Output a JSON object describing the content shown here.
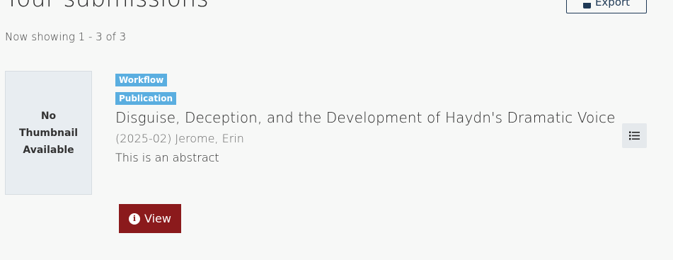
{
  "header": {
    "title": "Your submissions",
    "export_label": "Export"
  },
  "results": {
    "showing_text": "Now showing 1 - 3 of 3"
  },
  "item": {
    "thumbnail_text": "No Thumbnail Available",
    "badges": {
      "workflow": "Workflow",
      "publication": "Publication"
    },
    "title": "Disguise, Deception, and the Development of Haydn's Dramatic Voice",
    "meta": "(2025-02) Jerome, Erin",
    "abstract": "This is an abstract",
    "view_label": "View",
    "menu_icon": "list-icon",
    "info_icon": "info-icon"
  },
  "colors": {
    "badge": "#5aaee0",
    "view_button": "#8b1a1c",
    "export_border": "#1f3a56"
  }
}
